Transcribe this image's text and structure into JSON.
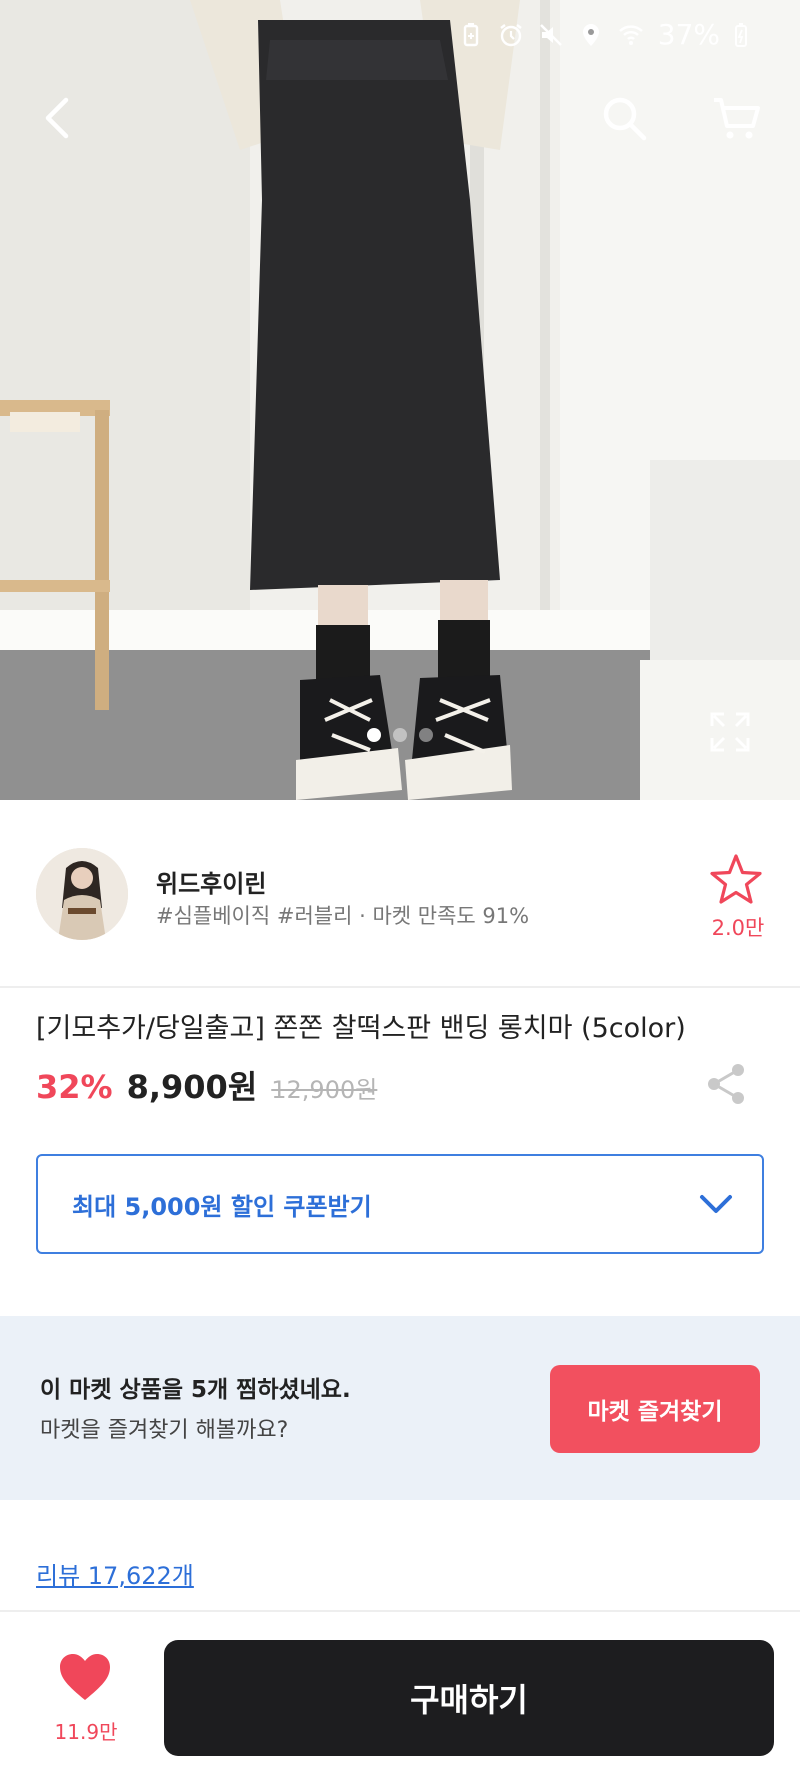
{
  "status_bar": {
    "battery": "37%",
    "icons": [
      "battery-saver-icon",
      "alarm-icon",
      "mute-icon",
      "location-icon",
      "wifi-icon",
      "battery-charging-icon"
    ]
  },
  "nav": {
    "back_icon": "back-arrow-icon",
    "search_icon": "search-icon",
    "cart_icon": "cart-icon"
  },
  "gallery": {
    "pages": 3,
    "active_index": 0,
    "expand_icon": "expand-icon"
  },
  "seller": {
    "name": "위드후이린",
    "tags": "#심플베이직 #러블리 · 마켓 만족도 91%",
    "favorite_count": "2.0만"
  },
  "product": {
    "title": "[기모추가/당일출고] 쫀쫀 찰떡스판 밴딩 롱치마 (5color)",
    "discount": "32%",
    "price": "8,900원",
    "original_price": "12,900원"
  },
  "coupon": {
    "label": "최대 5,000원 할인 쿠폰받기"
  },
  "market_banner": {
    "title": "이 마켓 상품을 5개 찜하셨네요.",
    "subtitle": "마켓을 즐겨찾기 해볼까요?",
    "button_label": "마켓 즐겨찾기"
  },
  "reviews": {
    "label": "리뷰 17,622개"
  },
  "bottom_bar": {
    "like_count": "11.9만",
    "buy_label": "구매하기"
  },
  "colors": {
    "accent_red": "#f0475a",
    "coupon_blue": "#2d6fd8",
    "banner_bg": "#ebf1f8",
    "buy_button": "#1d1d1f"
  }
}
